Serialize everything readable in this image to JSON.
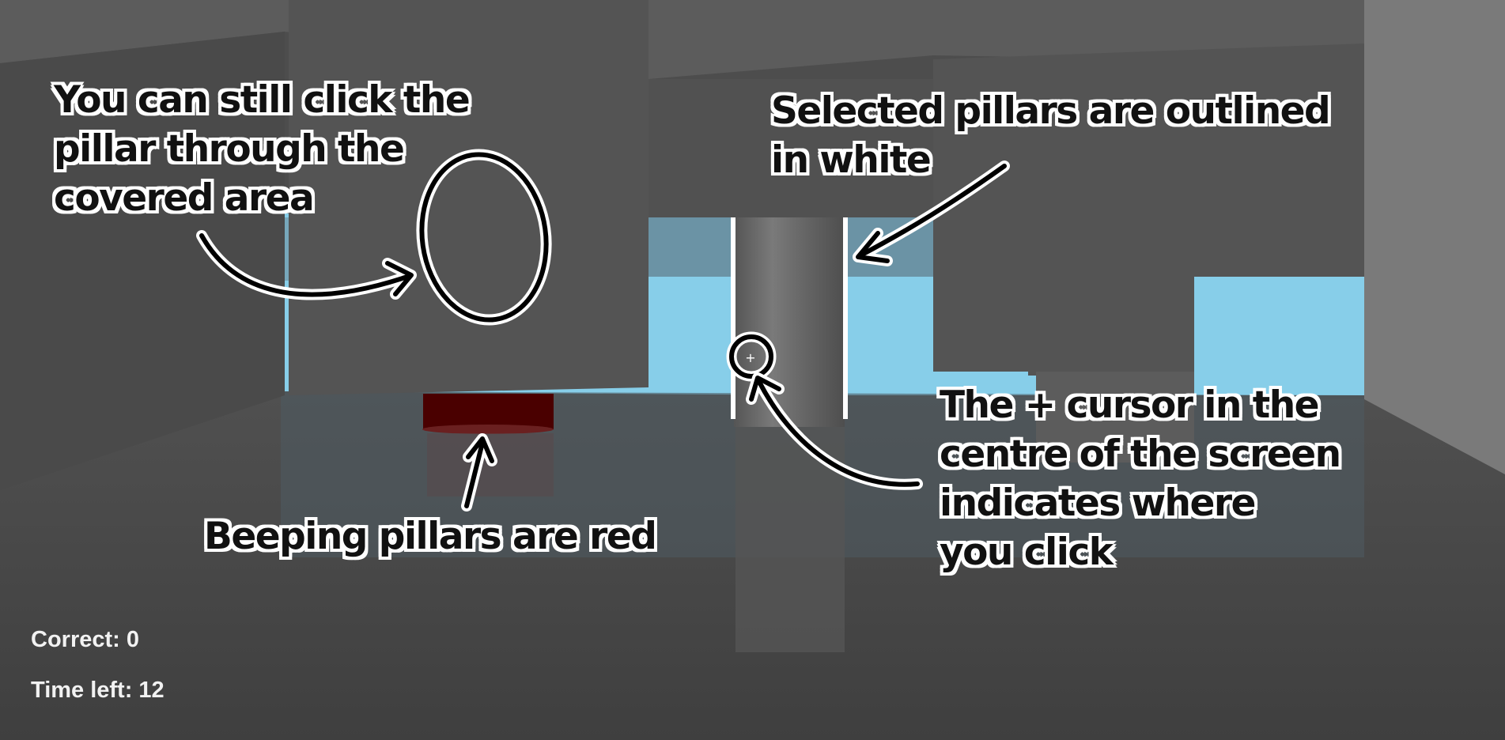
{
  "annotations": {
    "click_through": "You can still click the\npillar through the\ncovered area",
    "selected_outline": "Selected pillars are outlined\nin white",
    "beeping_red": "Beeping pillars are red",
    "cursor_hint": "The + cursor in the\ncentre of the screen\nindicates where\nyou click"
  },
  "crosshair": "+",
  "hud": {
    "correct_label": "Correct: 0",
    "time_left_label": "Time left: 12"
  },
  "colors": {
    "sky": "#87cee9",
    "beeping_pillar": "#4a0000",
    "selected_outline": "#ffffff"
  }
}
